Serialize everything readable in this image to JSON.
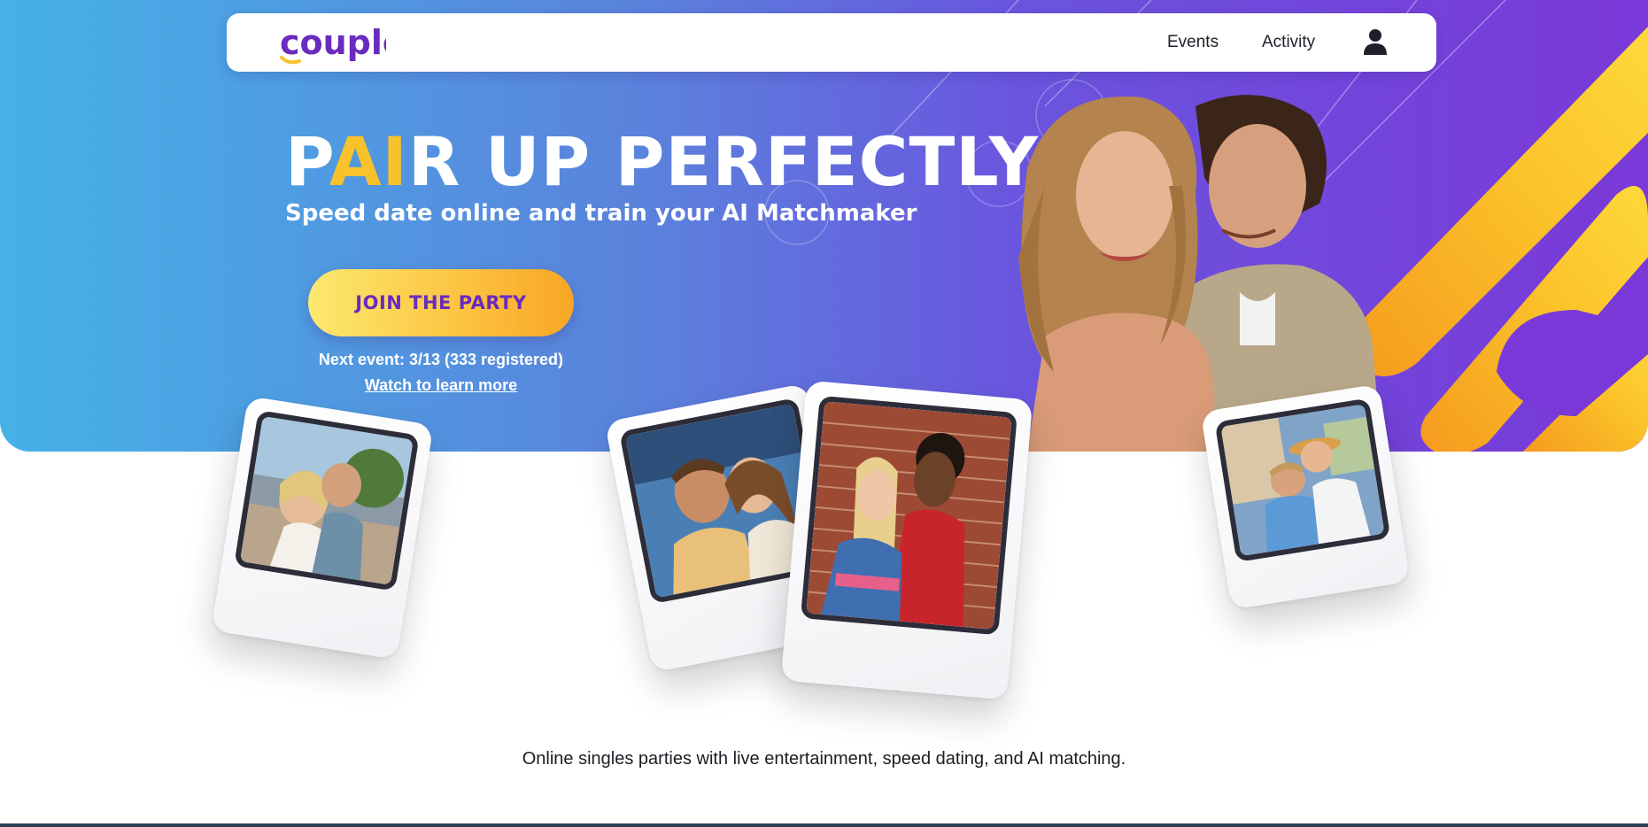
{
  "brand": {
    "logo_text": "couple",
    "logo_color": "#6a2bbf",
    "logo_accent": "#f7c22b"
  },
  "nav": {
    "events_label": "Events",
    "activity_label": "Activity",
    "profile_icon": "user-icon"
  },
  "hero": {
    "headline_p": "P",
    "headline_ai": "AI",
    "headline_rest": "R UP PERFECTLY",
    "subheadline": "Speed date online and train your AI Matchmaker",
    "cta_label": "JOIN THE PARTY",
    "next_event": "Next event: 3/13 (333 registered)",
    "watch_link": "Watch to learn more"
  },
  "colors": {
    "hero_gradient_start": "#45b2e6",
    "hero_gradient_end": "#7a38d8",
    "accent_yellow": "#f7c22b",
    "cta_text": "#6a2bbf"
  },
  "tagline": "Online singles parties with live entertainment, speed dating, and AI matching."
}
